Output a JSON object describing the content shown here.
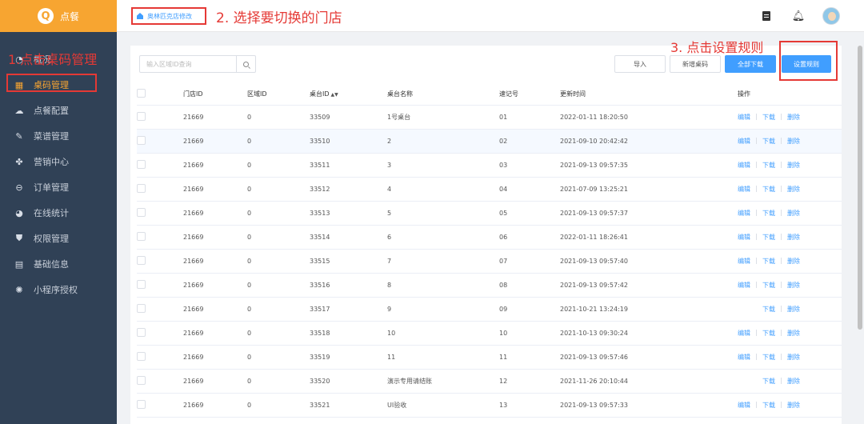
{
  "app": {
    "logo_letter": "Q",
    "name": "点餐"
  },
  "sidebar": {
    "items": [
      {
        "label": "概况",
        "icon": "dashboard-icon",
        "glyph": "◔",
        "active": false
      },
      {
        "label": "桌码管理",
        "icon": "qr-grid-icon",
        "glyph": "▦",
        "active": true
      },
      {
        "label": "点餐配置",
        "icon": "cloud-icon",
        "glyph": "☁",
        "active": false
      },
      {
        "label": "菜谱管理",
        "icon": "pin-icon",
        "glyph": "✎",
        "active": false
      },
      {
        "label": "营销中心",
        "icon": "apps-icon",
        "glyph": "✤",
        "active": false
      },
      {
        "label": "订单管理",
        "icon": "order-icon",
        "glyph": "⊖",
        "active": false
      },
      {
        "label": "在线统计",
        "icon": "pie-chart-icon",
        "glyph": "◕",
        "active": false
      },
      {
        "label": "权限管理",
        "icon": "shield-icon",
        "glyph": "⛊",
        "active": false
      },
      {
        "label": "基础信息",
        "icon": "store-icon",
        "glyph": "▤",
        "active": false
      },
      {
        "label": "小程序授权",
        "icon": "gear-icon",
        "glyph": "✺",
        "active": false
      }
    ]
  },
  "header": {
    "store_name": "奥林匹克店修改",
    "annotation": "2. 选择要切换的门店"
  },
  "annotations": {
    "step1": "1.点击桌码管理",
    "step3": "3. 点击设置规则"
  },
  "toolbar": {
    "search_placeholder": "输入区域ID查询",
    "import": "导入",
    "add_table_code": "新增桌码",
    "download_all": "全部下载",
    "set_rules": "设置规则"
  },
  "table": {
    "headers": {
      "store_id": "门店ID",
      "area_id": "区域ID",
      "table_id": "桌台ID",
      "table_name": "桌台名称",
      "memo": "速记号",
      "updated": "更新时间",
      "actions": "操作"
    },
    "action_labels": {
      "edit": "编辑",
      "download": "下载",
      "delete": "删除"
    },
    "rows": [
      {
        "store_id": "21669",
        "area_id": "0",
        "table_id": "33509",
        "name": "1号桌台",
        "memo": "01",
        "updated": "2022-01-11 18:20:50",
        "edit": true
      },
      {
        "store_id": "21669",
        "area_id": "0",
        "table_id": "33510",
        "name": "2",
        "memo": "02",
        "updated": "2021-09-10 20:42:42",
        "edit": true
      },
      {
        "store_id": "21669",
        "area_id": "0",
        "table_id": "33511",
        "name": "3",
        "memo": "03",
        "updated": "2021-09-13 09:57:35",
        "edit": true
      },
      {
        "store_id": "21669",
        "area_id": "0",
        "table_id": "33512",
        "name": "4",
        "memo": "04",
        "updated": "2021-07-09 13:25:21",
        "edit": true
      },
      {
        "store_id": "21669",
        "area_id": "0",
        "table_id": "33513",
        "name": "5",
        "memo": "05",
        "updated": "2021-09-13 09:57:37",
        "edit": true
      },
      {
        "store_id": "21669",
        "area_id": "0",
        "table_id": "33514",
        "name": "6",
        "memo": "06",
        "updated": "2022-01-11 18:26:41",
        "edit": true
      },
      {
        "store_id": "21669",
        "area_id": "0",
        "table_id": "33515",
        "name": "7",
        "memo": "07",
        "updated": "2021-09-13 09:57:40",
        "edit": true
      },
      {
        "store_id": "21669",
        "area_id": "0",
        "table_id": "33516",
        "name": "8",
        "memo": "08",
        "updated": "2021-09-13 09:57:42",
        "edit": true
      },
      {
        "store_id": "21669",
        "area_id": "0",
        "table_id": "33517",
        "name": "9",
        "memo": "09",
        "updated": "2021-10-21 13:24:19",
        "edit": false
      },
      {
        "store_id": "21669",
        "area_id": "0",
        "table_id": "33518",
        "name": "10",
        "memo": "10",
        "updated": "2021-10-13 09:30:24",
        "edit": true
      },
      {
        "store_id": "21669",
        "area_id": "0",
        "table_id": "33519",
        "name": "11",
        "memo": "11",
        "updated": "2021-09-13 09:57:46",
        "edit": true
      },
      {
        "store_id": "21669",
        "area_id": "0",
        "table_id": "33520",
        "name": "演示专用请结账",
        "memo": "12",
        "updated": "2021-11-26 20:10:44",
        "edit": false
      },
      {
        "store_id": "21669",
        "area_id": "0",
        "table_id": "33521",
        "name": "UI验收",
        "memo": "13",
        "updated": "2021-09-13 09:57:33",
        "edit": true
      }
    ]
  },
  "colors": {
    "sidebar_bg": "#304156",
    "logo_bg": "#f7a531",
    "accent_active": "#f7a531",
    "primary_blue": "#409eff",
    "annotation_red": "#e53935"
  }
}
